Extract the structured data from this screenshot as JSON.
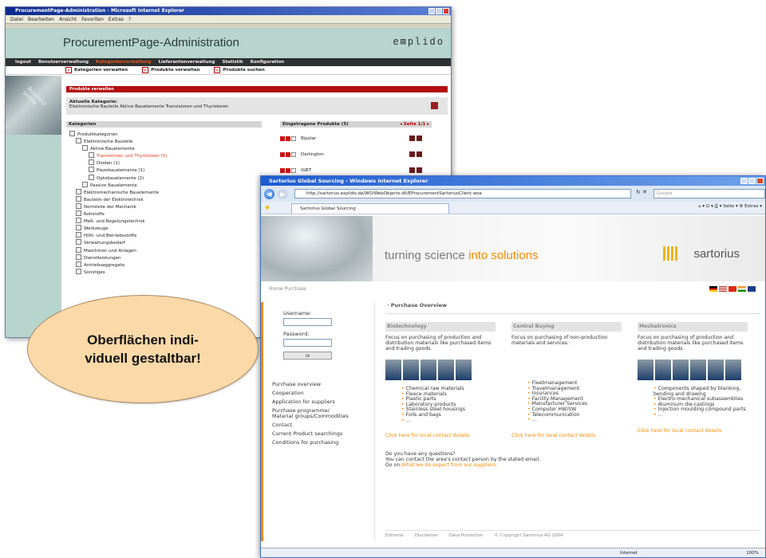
{
  "window1": {
    "title": "ProcurementPage-Administration - Microsoft Internet Explorer",
    "menu": [
      "Datei",
      "Bearbeiten",
      "Ansicht",
      "Favoriten",
      "Extras",
      "?"
    ],
    "header_title": "ProcurementPage-Administration",
    "logo": "e⊠plido",
    "nav": [
      "logout",
      "Benutzerverwaltung",
      "Kategorienverwaltung",
      "Lieferantenverwaltung",
      "Statistik",
      "Konfiguration"
    ],
    "subnav": [
      "Kategorien verwalten",
      "Produkte verwalten",
      "Produkte suchen"
    ],
    "side_photo_text": "Business online",
    "section_title": "Produkte verwalten",
    "current_category_label": "Aktuelle Kategorie:",
    "current_category_path": "Elektronische Bauteile   Aktive Bauelemente   Transistoren und Thyristoren",
    "col_categories": "Kategorien",
    "col_products": "Eingetragene Produkte (5)",
    "pager": "◂ Seite 1/1 ▸",
    "tree": [
      {
        "label": "Produktkategorien",
        "indent": 0,
        "red": false
      },
      {
        "label": "Elektronische Bauteile",
        "indent": 1,
        "red": false
      },
      {
        "label": "Aktive Bauelemente",
        "indent": 2,
        "red": false
      },
      {
        "label": "Transistoren und Thyristoren  (5)",
        "indent": 3,
        "red": true
      },
      {
        "label": "Dioden  (1)",
        "indent": 3,
        "red": false
      },
      {
        "label": "Piezobauelemente  (1)",
        "indent": 3,
        "red": false
      },
      {
        "label": "Optobauelemente  (2)",
        "indent": 3,
        "red": false
      },
      {
        "label": "Passive Bauelemente",
        "indent": 2,
        "red": false
      },
      {
        "label": "Elektromechanische Bauelemente",
        "indent": 1,
        "red": false
      },
      {
        "label": "Bauteile der Elektrotechnik",
        "indent": 1,
        "red": false
      },
      {
        "label": "Normteile der Mechanik",
        "indent": 1,
        "red": false
      },
      {
        "label": "Rohstoffe",
        "indent": 1,
        "red": false
      },
      {
        "label": "Meß- und Regelungstechnik",
        "indent": 1,
        "red": false
      },
      {
        "label": "Werkzeuge",
        "indent": 1,
        "red": false
      },
      {
        "label": "Hilfs- und Betriebsstoffe",
        "indent": 1,
        "red": false
      },
      {
        "label": "Verwaltungsbedarf",
        "indent": 1,
        "red": false
      },
      {
        "label": "Maschinen und Anlagen",
        "indent": 1,
        "red": false
      },
      {
        "label": "Dienstleistungen",
        "indent": 1,
        "red": false
      },
      {
        "label": "Antriebsaggregate",
        "indent": 1,
        "red": false
      },
      {
        "label": "Sonstiges",
        "indent": 1,
        "red": false
      }
    ],
    "products": [
      "Bipolar",
      "Darlington",
      "IGBT"
    ]
  },
  "window2": {
    "title": "Sartorius Global Sourcing - Windows Internet Explorer",
    "url": "http://sartorius.explido.de/WO/WebObjects.dll/EProcurementSartoriusClient.woa",
    "search_placeholder": "Google",
    "tab": "Sartorius Global Sourcing",
    "tools": "⌂ ▾  ⊡ ▾  ⎙ ▾  Seite ▾  ⚙ Extras ▾",
    "tagline_grey": "turning science ",
    "tagline_orange": "into solutions",
    "brand": "sartorius",
    "breadcrumb": "Home  Purchase",
    "username_label": "Username:",
    "password_label": "Password:",
    "ok_label": "OK",
    "left_links": [
      "Purchase overview",
      "Cooperation",
      "Application for suppliers",
      "Purchase programme/",
      "Material groups/Commodities",
      "Contact",
      "Current Product searchings",
      "Conditions for purchasing"
    ],
    "page_title": "· Purchase Overview",
    "columns": [
      {
        "heading": "Biotechnology",
        "text": "Focus on purchasing of production and distribution materials like purchased items and trading goods.",
        "items": [
          "Chemical raw materials",
          "Fleece materials",
          "Plastic parts",
          "Laboratory products",
          "Stainless steel housings",
          "Foils and bags",
          "..."
        ],
        "link": "Click here for local contact details"
      },
      {
        "heading": "Central Buying",
        "text": "Focus on purchasing of non-production materials and services.",
        "items": [
          "Fleetmanagement",
          "Travelmanagement",
          "Insurances",
          "Facility-Management",
          "Manufacturer Services",
          "Computer HW/SW",
          "Telecommunication",
          "..."
        ],
        "link": "Click here for local contact details"
      },
      {
        "heading": "Mechatronics",
        "text": "Focus on purchasing of production and distribution materials like purchased items and trading goods.",
        "items": [
          "Components shaped by blanking, bending and drawing",
          "Electro-mechanical subassemblies",
          "Aluminum die-castings",
          "Injection moulding compound parts",
          "..."
        ],
        "link": "Click here for local contact details"
      }
    ],
    "question1": "Do you have any questions?",
    "question2": "You can contact the area's contact person by the stated email.",
    "goon": "Go on:",
    "goon_link": "What we do expect from our suppliers.",
    "footer": [
      "Editorial",
      "Disclaimer",
      "Data Protection",
      "© Copyright Sartorius AG 2004"
    ],
    "status_zone": "Internet",
    "zoom": "100%"
  },
  "bubble": {
    "line1": "Oberflächen indi-",
    "line2": "viduell gestaltbar!"
  }
}
